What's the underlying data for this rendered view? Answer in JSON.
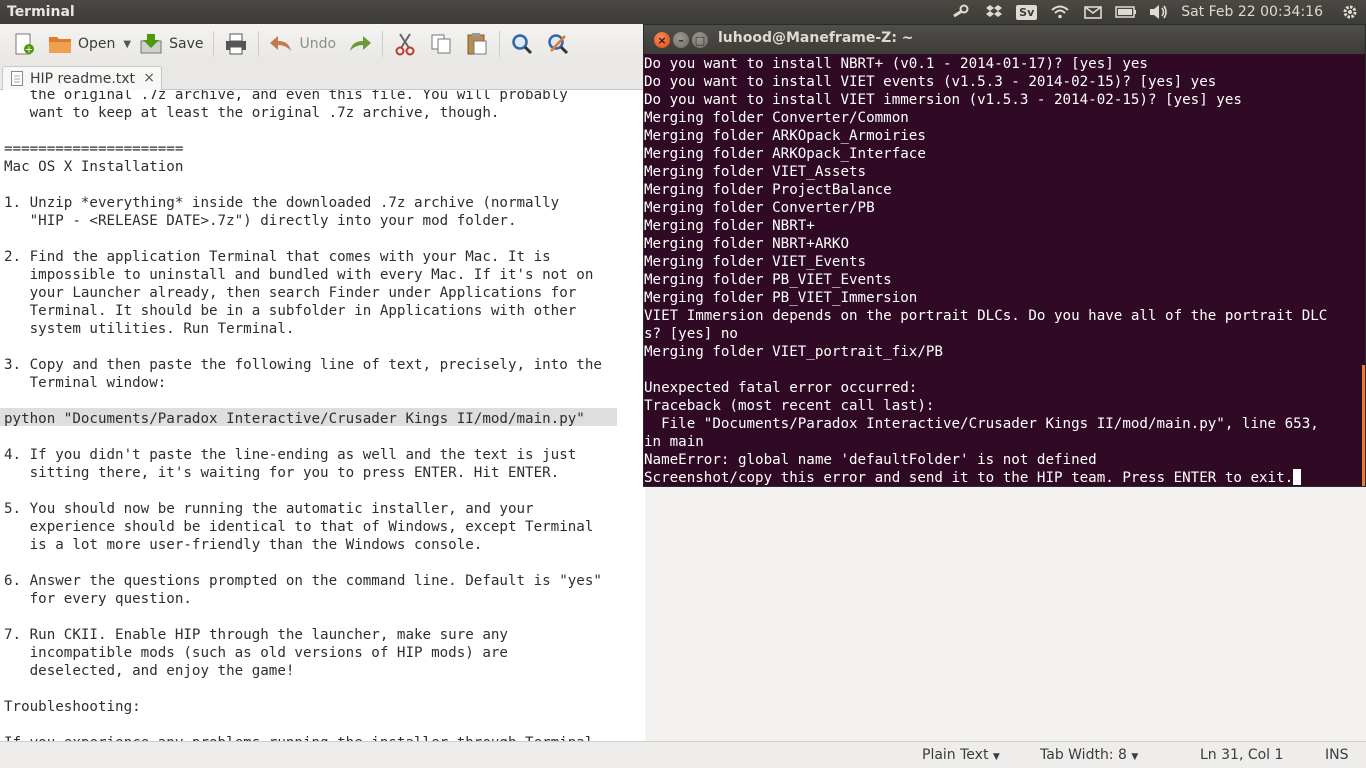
{
  "panel": {
    "app_title": "Terminal",
    "keyboard_layout": "Sv",
    "clock": "Sat Feb 22  00:34:16"
  },
  "toolbar": {
    "open_label": "Open",
    "save_label": "Save",
    "undo_label": "Undo"
  },
  "tab": {
    "filename": "HIP readme.txt",
    "close": "×"
  },
  "editor": {
    "lines": [
      "   the original .7z archive, and even this file. You will probably",
      "   want to keep at least the original .7z archive, though.",
      "",
      "=====================",
      "Mac OS X Installation",
      "",
      "1. Unzip *everything* inside the downloaded .7z archive (normally",
      "   \"HIP - <RELEASE DATE>.7z\") directly into your mod folder.",
      "",
      "2. Find the application Terminal that comes with your Mac. It is",
      "   impossible to uninstall and bundled with every Mac. If it's not on",
      "   your Launcher already, then search Finder under Applications for",
      "   Terminal. It should be in a subfolder in Applications with other",
      "   system utilities. Run Terminal.",
      "",
      "3. Copy and then paste the following line of text, precisely, into the",
      "   Terminal window:",
      "",
      "python \"Documents/Paradox Interactive/Crusader Kings II/mod/main.py\"",
      "",
      "4. If you didn't paste the line-ending as well and the text is just",
      "   sitting there, it's waiting for you to press ENTER. Hit ENTER.",
      "",
      "5. You should now be running the automatic installer, and your",
      "   experience should be identical to that of Windows, except Terminal",
      "   is a lot more user-friendly than the Windows console.",
      "",
      "6. Answer the questions prompted on the command line. Default is \"yes\"",
      "   for every question.",
      "",
      "7. Run CKII. Enable HIP through the launcher, make sure any",
      "   incompatible mods (such as old versions of HIP mods) are",
      "   deselected, and enjoy the game!",
      "",
      "Troubleshooting:",
      "",
      "If you experience any problems running the installer through Terminal"
    ]
  },
  "statusbar": {
    "language": "Plain Text",
    "tab_width": "Tab Width:  8",
    "position": "Ln 31, Col 1",
    "mode": "INS"
  },
  "terminal": {
    "title": "luhood@Maneframe-Z: ~",
    "lines": [
      "Do you want to install NBRT+ (v0.1 - 2014-01-17)? [yes] yes",
      "Do you want to install VIET events (v1.5.3 - 2014-02-15)? [yes] yes",
      "Do you want to install VIET immersion (v1.5.3 - 2014-02-15)? [yes] yes",
      "Merging folder Converter/Common",
      "Merging folder ARKOpack_Armoiries",
      "Merging folder ARKOpack_Interface",
      "Merging folder VIET_Assets",
      "Merging folder ProjectBalance",
      "Merging folder Converter/PB",
      "Merging folder NBRT+",
      "Merging folder NBRT+ARKO",
      "Merging folder VIET_Events",
      "Merging folder PB_VIET_Events",
      "Merging folder PB_VIET_Immersion",
      "VIET Immersion depends on the portrait DLCs. Do you have all of the portrait DLC",
      "s? [yes] no",
      "Merging folder VIET_portrait_fix/PB",
      "",
      "Unexpected fatal error occurred:",
      "Traceback (most recent call last):",
      "  File \"Documents/Paradox Interactive/Crusader Kings II/mod/main.py\", line 653,",
      "in main",
      "NameError: global name 'defaultFolder' is not defined",
      "Screenshot/copy this error and send it to the HIP team. Press ENTER to exit."
    ]
  }
}
